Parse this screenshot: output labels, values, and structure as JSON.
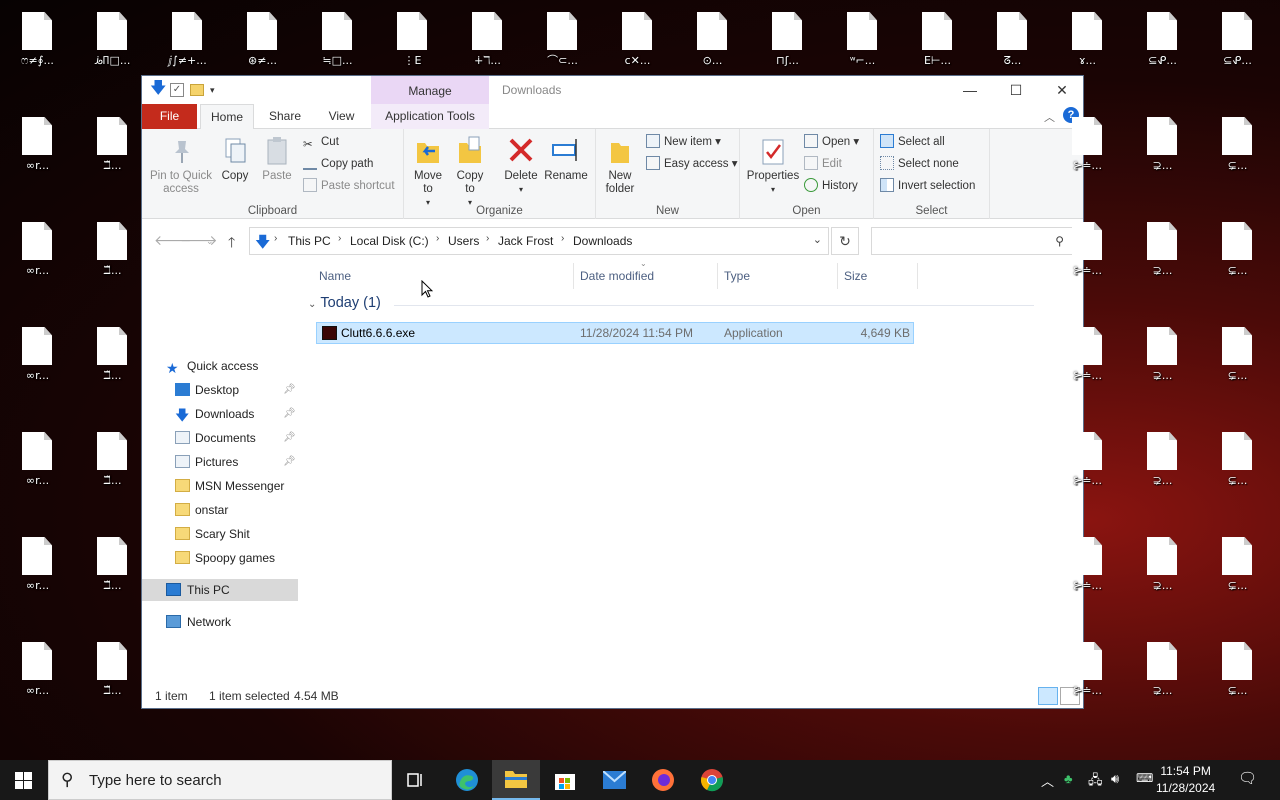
{
  "desktop": {
    "icon_captions": [
      [
        "ෆ≠∮...",
        "ꚤꛛ□...",
        "ⅉ∫≠+...",
        "⊛≠...",
        "≒□...",
        "⋮E",
        "∔ℸ...",
        "⌒⊂...",
        "c✕...",
        "⊙...",
        "⊓ʃ...",
        "ʷ⌐...",
        "E⊢...",
        "ᘔ...",
        "ɤ...",
        "⊆ᕵ..."
      ],
      [
        "∞r...",
        "ℶ̃...",
        "",
        "",
        "",
        "",
        "",
        "",
        "",
        "",
        "",
        "",
        "",
        "⊱≐...",
        "⊋...",
        "⊊..."
      ]
    ]
  },
  "window": {
    "title": "Downloads",
    "manage_tab": "Manage",
    "controls": {
      "minimize": "—",
      "maximize": "☐",
      "close": "✕"
    }
  },
  "tabs": {
    "file": "File",
    "home": "Home",
    "share": "Share",
    "view": "View",
    "app_tools": "Application Tools"
  },
  "ribbon": {
    "clipboard": {
      "label": "Clipboard",
      "pin": "Pin to Quick access",
      "copy": "Copy",
      "paste": "Paste",
      "cut": "Cut",
      "copy_path": "Copy path",
      "paste_shortcut": "Paste shortcut"
    },
    "organize": {
      "label": "Organize",
      "move_to": "Move to",
      "copy_to": "Copy to",
      "delete": "Delete",
      "rename": "Rename"
    },
    "new": {
      "label": "New",
      "new_folder": "New folder",
      "new_item": "New item",
      "easy_access": "Easy access"
    },
    "open": {
      "label": "Open",
      "properties": "Properties",
      "open": "Open",
      "edit": "Edit",
      "history": "History"
    },
    "select": {
      "label": "Select",
      "select_all": "Select all",
      "select_none": "Select none",
      "invert": "Invert selection"
    }
  },
  "address": {
    "crumbs": [
      "This PC",
      "Local Disk (C:)",
      "Users",
      "Jack Frost",
      "Downloads"
    ],
    "search_placeholder": ""
  },
  "nav": {
    "quick_access": "Quick access",
    "items": [
      {
        "label": "Desktop",
        "pinned": true
      },
      {
        "label": "Downloads",
        "pinned": true
      },
      {
        "label": "Documents",
        "pinned": true
      },
      {
        "label": "Pictures",
        "pinned": true
      },
      {
        "label": "MSN Messenger",
        "pinned": false
      },
      {
        "label": "onstar",
        "pinned": false
      },
      {
        "label": "Scary Shit",
        "pinned": false
      },
      {
        "label": "Spoopy games",
        "pinned": false
      }
    ],
    "this_pc": "This PC",
    "network": "Network"
  },
  "columns": {
    "name": "Name",
    "date": "Date modified",
    "type": "Type",
    "size": "Size"
  },
  "group": {
    "label": "Today (1)"
  },
  "files": [
    {
      "name": "Clutt6.6.6.exe",
      "date": "11/28/2024 11:54 PM",
      "type": "Application",
      "size": "4,649 KB"
    }
  ],
  "status": {
    "count": "1 item",
    "selected": "1 item selected",
    "size": "4.54 MB"
  },
  "taskbar": {
    "search_placeholder": "Type here to search",
    "time": "11:54 PM",
    "date": "11/28/2024"
  }
}
